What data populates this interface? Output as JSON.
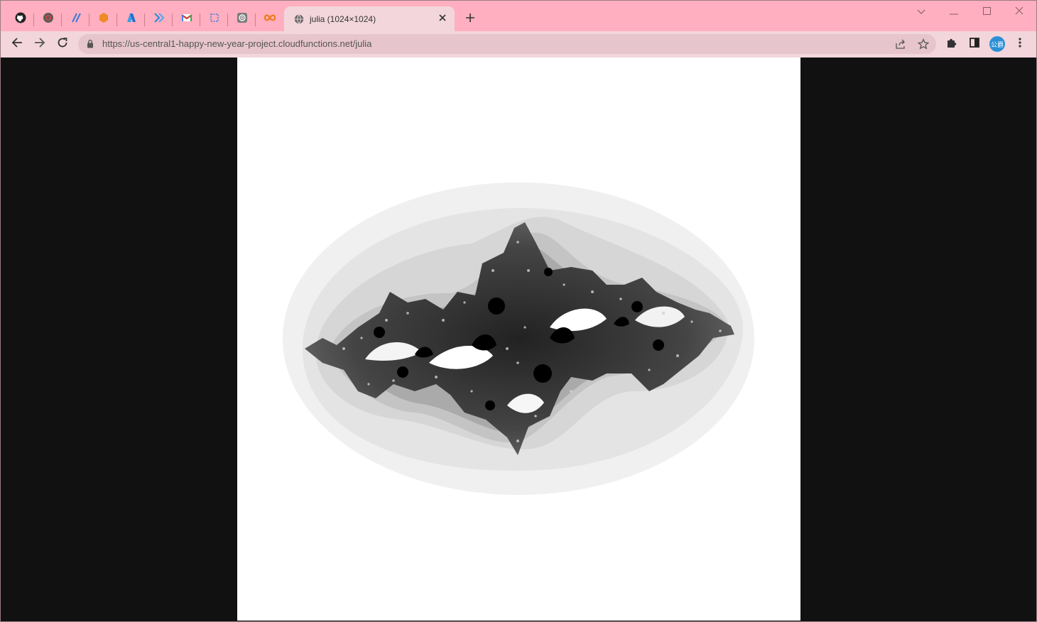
{
  "browser": {
    "pinned_tabs": [
      {
        "icon": "github-icon"
      },
      {
        "icon": "chromium-ring-icon"
      },
      {
        "icon": "slash-app-icon"
      },
      {
        "icon": "orange-hexagon-icon"
      },
      {
        "icon": "azure-icon"
      },
      {
        "icon": "chevrons-icon"
      },
      {
        "icon": "gmail-icon"
      },
      {
        "icon": "dotted-square-icon"
      },
      {
        "icon": "openai-icon"
      },
      {
        "icon": "infinity-icon"
      }
    ],
    "active_tab": {
      "title": "julia (1024×1024)",
      "favicon": "globe-icon"
    },
    "url": "https://us-central1-happy-new-year-project.cloudfunctions.net/julia",
    "profile_avatar_text": "公爵",
    "colors": {
      "tabstrip": "#ffafbf",
      "toolbar": "#f2d6dc",
      "omnibox": "#e7c5cc",
      "viewer_background": "#111111",
      "avatar": "#2b8fd6"
    }
  },
  "viewer": {
    "image_title": "julia (1024×1024)",
    "image_size": "1024×1024"
  }
}
